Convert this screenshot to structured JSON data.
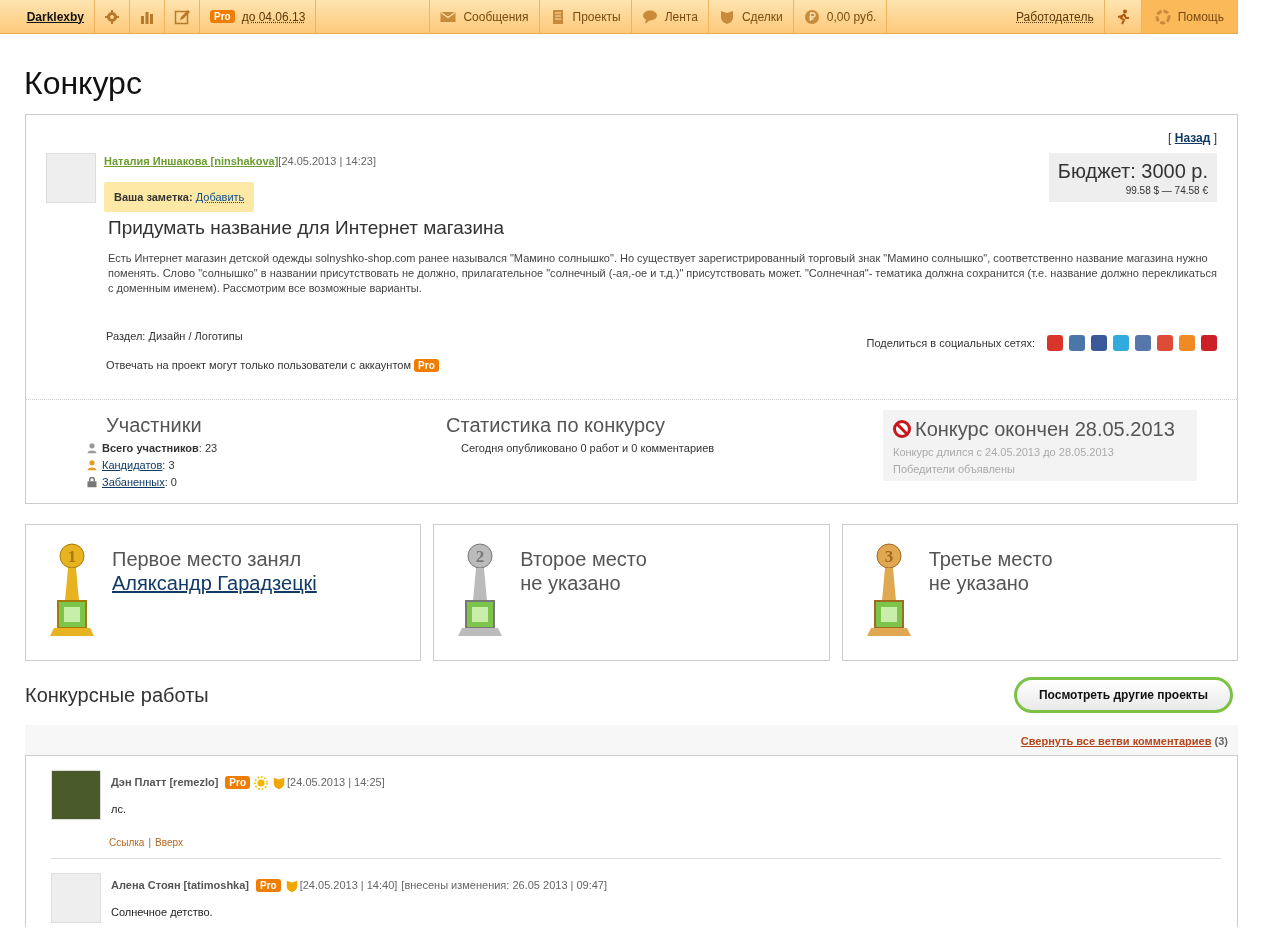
{
  "topbar": {
    "user": "Darklexby",
    "pro_badge": "Pro",
    "pro_until": "до 04.06.13",
    "nav": [
      {
        "label": "Сообщения"
      },
      {
        "label": "Проекты"
      },
      {
        "label": "Лента"
      },
      {
        "label": "Сделки"
      },
      {
        "label": "0,00 руб."
      }
    ],
    "employer": "Работодатель",
    "help": "Помощь"
  },
  "page_title": "Конкурс",
  "project": {
    "back": {
      "open": "[",
      "label": "Назад",
      "close": "]"
    },
    "author": "Наталия Иншакова [ninshakova]",
    "date": "[24.05.2013 | 14:23]",
    "note_label": "Ваша заметка:",
    "note_link": "Добавить",
    "budget": "Бюджет: 3000 р.",
    "budget_converted": "99.58 $ — 74.58 €",
    "title": "Придумать название для Интернет магазина",
    "description": "Есть Интернет магазин детской одежды solnyshko-shop.com ранее назывался \"Мамино солнышко\". Но существует зарегистрированный торговый знак \"Мамино солнышко\", соответственно название магазина нужно поменять. Слово \"солнышко\" в названии присутствовать не должно, прилагательное \"солнечный (-ая,-ое и т.д.)\" присутствовать может. \"Солнечная\"- тематика должна сохранится (т.е. название должно перекликаться с доменным именем). Рассмотрим все возможные варианты.",
    "section": "Раздел: Дизайн / Логотипы",
    "share_label": "Поделиться в социальных сетях:",
    "restriction": "Отвечать на проект могут только пользователи с аккаунтом",
    "restriction_badge": "Pro"
  },
  "participants": {
    "title": "Участники",
    "rows": [
      {
        "kind": "bold",
        "label": "Всего участников",
        "value": ": 23"
      },
      {
        "kind": "link",
        "label": "Кандидатов",
        "value": ": 3"
      },
      {
        "kind": "link",
        "label": "Забаненных",
        "value": ": 0"
      }
    ]
  },
  "stats": {
    "title": "Статистика по конкурсу",
    "text": "Сегодня опубликовано 0 работ и 0 комментариев"
  },
  "status": {
    "title": "Конкурс окончен 28.05.2013",
    "lines": [
      "Конкурс длился с 24.05.2013 до 28.05.2013",
      "Победители объявлены"
    ]
  },
  "places": [
    {
      "rank": "1",
      "heading": "Первое место занял",
      "kind": "winner",
      "second": "Аляксандр Гарадзецкi"
    },
    {
      "rank": "2",
      "heading": "Второе место",
      "kind": "none",
      "second": "не указано"
    },
    {
      "rank": "3",
      "heading": "Третье место",
      "kind": "none",
      "second": "не указано"
    }
  ],
  "works": {
    "title": "Конкурсные работы",
    "button": "Посмотреть другие проекты",
    "collapse_link": "Свернуть все ветви комментариев",
    "count": "(3)"
  },
  "comments": [
    {
      "has_photo": true,
      "author": "Дэн Платт [remezlo]",
      "pro": "Pro",
      "sun_badge": true,
      "date": "[24.05.2013 | 14:25]",
      "body": "лс.",
      "links": [
        "Ссылка",
        "Вверх"
      ],
      "link_separator": "|"
    },
    {
      "has_photo": false,
      "author": "Алена Стоян [tatimoshka]",
      "pro": "Pro",
      "sun_badge": false,
      "date": "[24.05.2013 | 14:40]",
      "edited": "[внесены изменения: 26.05 2013 | 09:47]",
      "body": "Солнечное детство."
    }
  ]
}
